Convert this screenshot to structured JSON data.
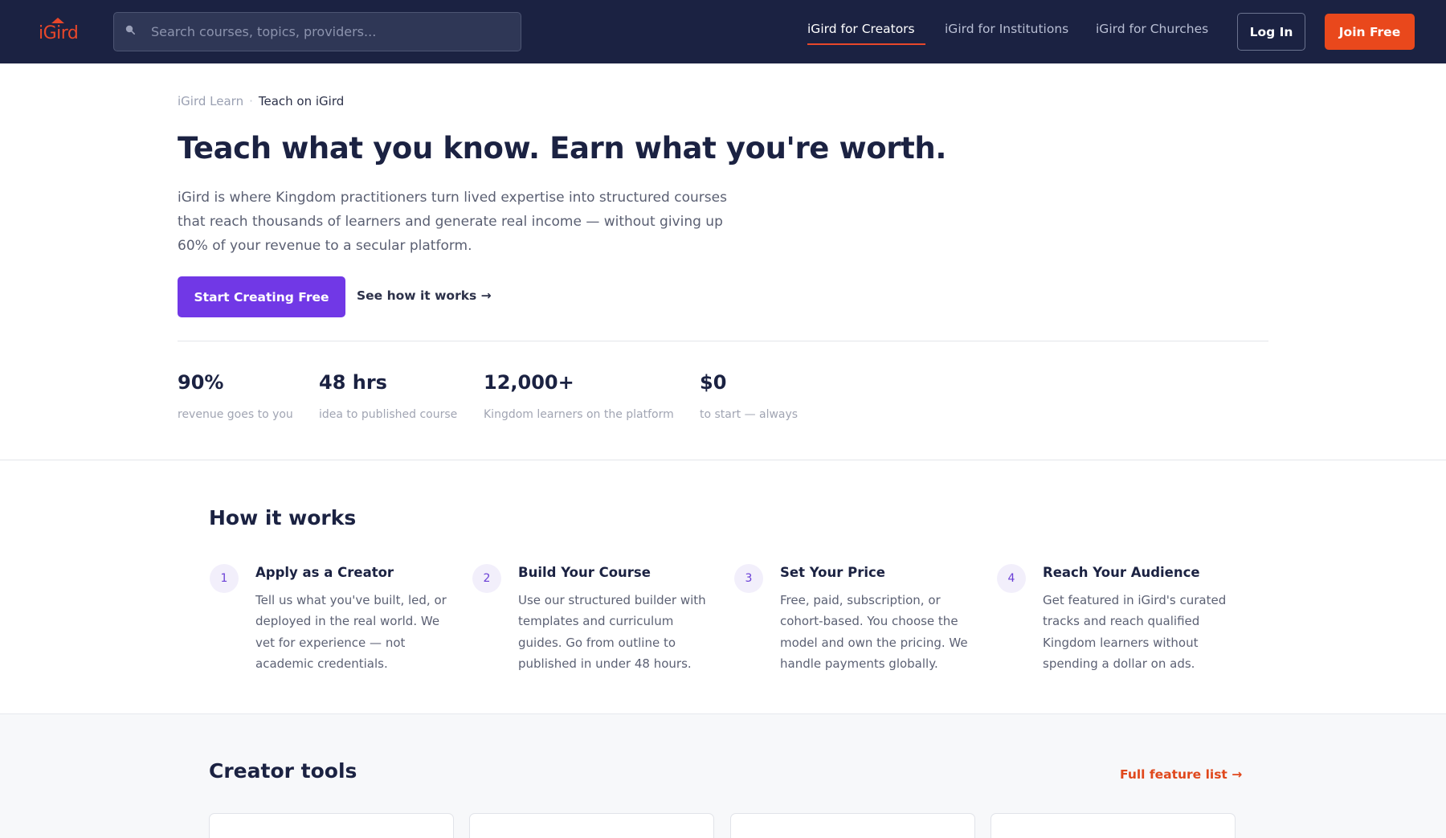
{
  "header": {
    "logo_text": "iGird",
    "search_placeholder": "Search courses, topics, providers...",
    "nav": [
      {
        "label": "iGird for Creators",
        "active": true
      },
      {
        "label": "iGird for Institutions",
        "active": false
      },
      {
        "label": "iGird for Churches",
        "active": false
      }
    ],
    "login_label": "Log In",
    "join_label": "Join Free"
  },
  "breadcrumb": [
    "iGird Learn",
    "Teach on iGird"
  ],
  "hero": {
    "title": "Teach what you know. Earn what you're worth.",
    "description": "iGird is where Kingdom practitioners turn lived expertise into structured courses that reach thousands of learners and generate real income — without giving up 60% of your revenue to a secular platform.",
    "primary_cta": "Start Creating Free",
    "secondary_cta": "See how it works →"
  },
  "stats": [
    {
      "value": "90%",
      "label": "revenue goes to you"
    },
    {
      "value": "48 hrs",
      "label": "idea to published course"
    },
    {
      "value": "12,000+",
      "label": "Kingdom learners on the platform"
    },
    {
      "value": "$0",
      "label": "to start — always"
    }
  ],
  "how_it_works": {
    "title": "How it works",
    "steps": [
      {
        "num": "1",
        "title": "Apply as a Creator",
        "desc": "Tell us what you've built, led, or deployed in the real world. We vet for experience — not academic credentials."
      },
      {
        "num": "2",
        "title": "Build Your Course",
        "desc": "Use our structured builder with templates and curriculum guides. Go from outline to published in under 48 hours."
      },
      {
        "num": "3",
        "title": "Set Your Price",
        "desc": "Free, paid, subscription, or cohort-based. You choose the model and own the pricing. We handle payments globally."
      },
      {
        "num": "4",
        "title": "Reach Your Audience",
        "desc": "Get featured in iGird's curated tracks and reach qualified Kingdom learners without spending a dollar on ads."
      }
    ]
  },
  "creator_tools": {
    "title": "Creator tools",
    "link": "Full feature list →"
  },
  "colors": {
    "header_bg": "#1b2242",
    "accent_orange": "#e9481c",
    "primary_purple": "#7138e6",
    "text_dark": "#1b2242"
  },
  "icons": {
    "search": "search-icon",
    "logo": "house-roof-icon"
  }
}
